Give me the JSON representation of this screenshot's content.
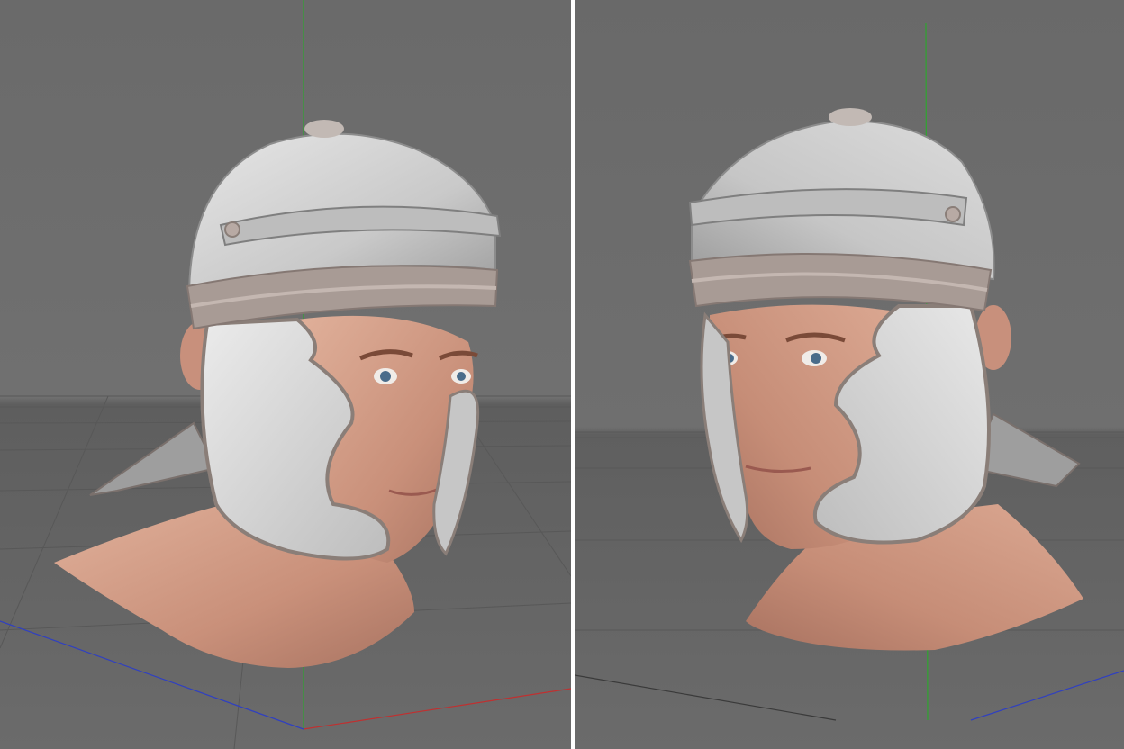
{
  "layout": "split-viewport",
  "background_color": "#6b6b6b",
  "viewports": [
    {
      "id": "left",
      "view": "perspective",
      "model": "head-with-galea-helmet",
      "facing": "right",
      "axes": [
        "x-axis-red",
        "y-axis-green",
        "z-axis-blue"
      ]
    },
    {
      "id": "right",
      "view": "perspective",
      "model": "head-with-galea-helmet",
      "facing": "left",
      "axes": [
        "y-axis-green",
        "z-axis-blue",
        "x-axis-grey"
      ]
    }
  ],
  "colors": {
    "helmet": "#cfcfcf",
    "helmet_band": "#a89b95",
    "skin": "#d6a28c",
    "axis_x": "#c03030",
    "axis_y": "#2fa52f",
    "axis_z": "#3040c0",
    "grid": "#5a5a5a"
  }
}
